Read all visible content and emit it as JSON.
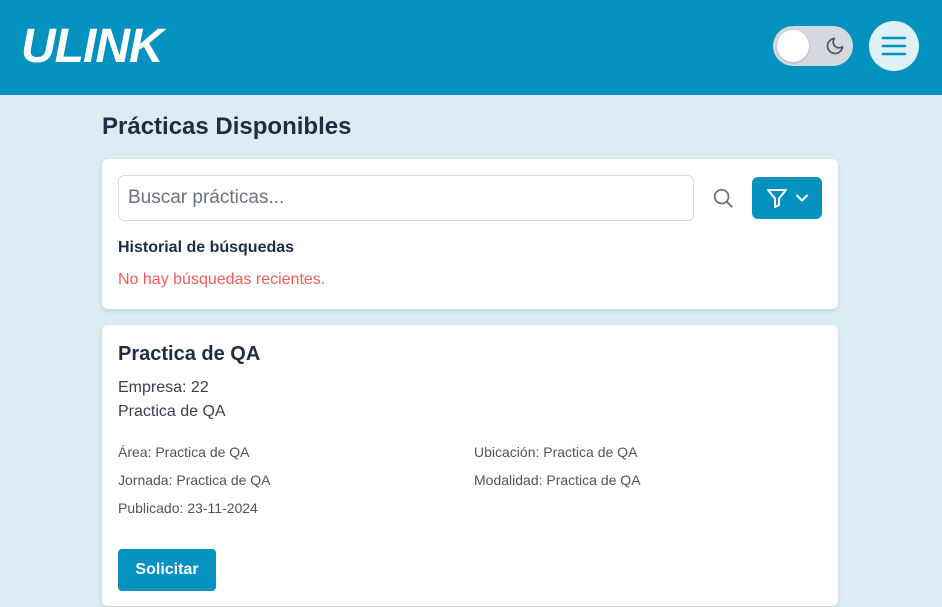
{
  "header": {
    "logo": "ULINK",
    "theme_toggle_icon": "moon-icon",
    "menu_icon": "hamburger-menu-icon",
    "brand_color": "#0391bf"
  },
  "page": {
    "title": "Prácticas Disponibles"
  },
  "search": {
    "placeholder": "Buscar prácticas...",
    "value": "",
    "search_icon": "search-icon",
    "filter_icon": "filter-icon",
    "history_title": "Historial de búsquedas",
    "history_empty": "No hay búsquedas recientes."
  },
  "job": {
    "title": "Practica de QA",
    "company": "Empresa: 22",
    "subtitle": "Practica de QA",
    "area": "Área: Practica de QA",
    "location": "Ubicación: Practica de QA",
    "schedule": "Jornada: Practica de QA",
    "modality": "Modalidad: Practica de QA",
    "published": "Publicado: 23-11-2024",
    "apply_label": "Solicitar"
  }
}
